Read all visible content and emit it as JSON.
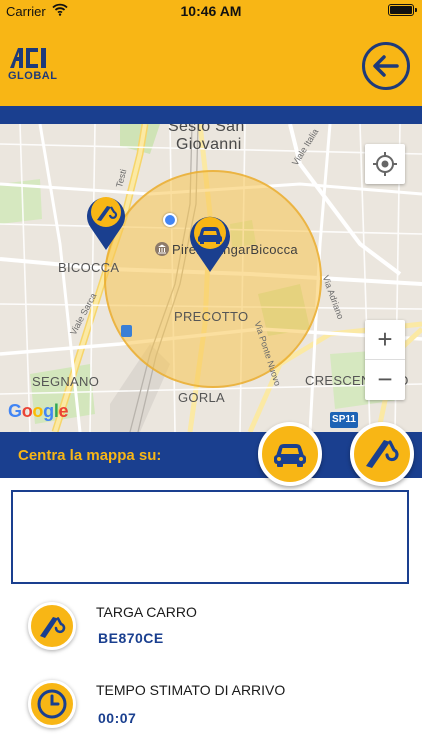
{
  "status_bar": {
    "carrier": "Carrier",
    "time": "10:46 AM"
  },
  "header": {
    "logo_text": "GLOBAL",
    "logo_brand": "ACI",
    "back_icon": "arrow-left-icon"
  },
  "colors": {
    "brand_yellow": "#f8b615",
    "brand_blue": "#1a3f8f",
    "radius_circle": "#f7c450"
  },
  "map": {
    "labels": {
      "sesto": "Sesto San",
      "giovanni": "Giovanni",
      "bicocca": "BICOCCA",
      "pirelli": "PirelliHangarBicocca",
      "precotto": "PRECOTTO",
      "segnano": "SEGNANO",
      "gorla": "GORLA",
      "crescenzago": "CRESCENZAGO"
    },
    "streets": {
      "viale_sarca": "Viale Sarca",
      "via_adriano": "Via Adriano",
      "via_ponte_nuovo": "Via Ponte Nuovo",
      "viale_italia": "Viale Italia",
      "testi": "Testi"
    },
    "road_badge": "SP11",
    "attribution": "Google",
    "controls": {
      "zoom_in": "+",
      "zoom_out": "−"
    }
  },
  "center_bar": {
    "label": "Centra la mappa su:"
  },
  "details": {
    "plate_label": "TARGA CARRO",
    "plate_value": "BE870CE",
    "eta_label": "TEMPO STIMATO DI ARRIVO",
    "eta_value": "00:07"
  }
}
